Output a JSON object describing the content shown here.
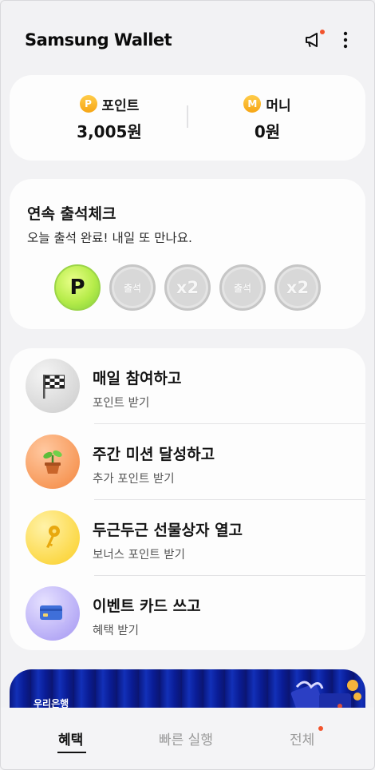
{
  "header": {
    "title": "Samsung Wallet",
    "icons": [
      "megaphone-icon",
      "more-vertical-icon"
    ],
    "accent_dot_color": "#f2542d"
  },
  "points": {
    "point": {
      "coin": "P",
      "label": "포인트",
      "value": "3,005원"
    },
    "money": {
      "coin": "M",
      "label": "머니",
      "value": "0원"
    }
  },
  "attendance": {
    "title": "연속 출석체크",
    "subtitle": "오늘 출석 완료! 내일 또 만나요.",
    "stamps": [
      {
        "label": "P",
        "state": "done"
      },
      {
        "label": "출석",
        "state": "pending"
      },
      {
        "label": "x2",
        "state": "pending"
      },
      {
        "label": "출석",
        "state": "pending"
      },
      {
        "label": "x2",
        "state": "pending"
      }
    ]
  },
  "missions": [
    {
      "title": "매일 참여하고",
      "subtitle": "포인트 받기",
      "icon": "checkered-flag-icon"
    },
    {
      "title": "주간 미션 달성하고",
      "subtitle": "추가 포인트 받기",
      "icon": "plant-pot-icon"
    },
    {
      "title": "두근두근 선물상자 열고",
      "subtitle": "보너스 포인트 받기",
      "icon": "key-icon"
    },
    {
      "title": "이벤트 카드 쓰고",
      "subtitle": "혜택 받기",
      "icon": "credit-card-icon"
    }
  ],
  "banner": {
    "label": "우리은행"
  },
  "bottom_nav": {
    "tabs": [
      {
        "label": "혜택",
        "active": true
      },
      {
        "label": "빠른 실행",
        "active": false
      },
      {
        "label": "전체",
        "active": false,
        "badge": true
      }
    ]
  }
}
